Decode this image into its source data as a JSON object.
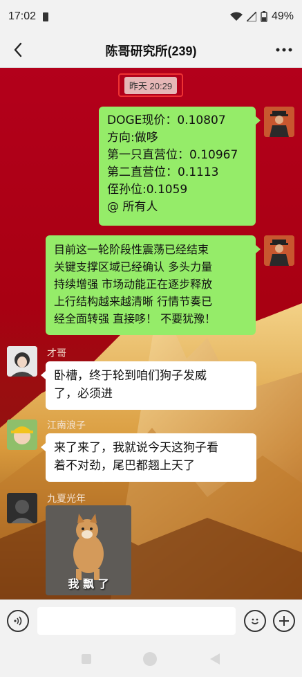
{
  "status_bar": {
    "time": "17:02",
    "battery": "49%",
    "icons": [
      "sd-card-icon",
      "wifi-icon",
      "signal-icon",
      "battery-icon"
    ]
  },
  "header": {
    "title": "陈哥研究所(239)",
    "back_icon": "chevron-left-icon",
    "more_icon": "more-dots-icon"
  },
  "chat": {
    "timestamp": "昨天 20:29",
    "messages": [
      {
        "type": "outgoing",
        "lines": [
          "DOGE现价：0.10807",
          "方向:做哆",
          "第一只直营位：0.10967",
          "第二直营位：0.1113",
          "侄孙位:0.1059",
          "@ 所有人"
        ]
      },
      {
        "type": "outgoing",
        "lines": [
          "目前这一轮阶段性震荡已经结束",
          "关键支撑区域已经确认 多头力量",
          "持续增强 市场动能正在逐步释放",
          "上行结构越来越清晰 行情节奏已",
          "经全面转强 直接哆！ 不要犹豫！"
        ]
      },
      {
        "type": "incoming",
        "sender": "才哥",
        "lines": [
          "卧槽，终于轮到咱们狗子发威",
          "了，必须进"
        ]
      },
      {
        "type": "incoming",
        "sender": "江南浪子",
        "lines": [
          "来了来了，我就说今天这狗子看",
          "着不对劲，尾巴都翘上天了"
        ]
      },
      {
        "type": "incoming-sticker",
        "sender": "九夏光年",
        "caption": "我 飘 了"
      }
    ]
  },
  "input_bar": {
    "voice_icon": "voice-icon",
    "emoji_icon": "emoji-icon",
    "plus_icon": "plus-icon",
    "placeholder": ""
  },
  "colors": {
    "chat_bg": "#b3001b",
    "outgoing_bubble": "#95ec69",
    "incoming_bubble": "#ffffff",
    "highlight_box": "#ee3333"
  }
}
